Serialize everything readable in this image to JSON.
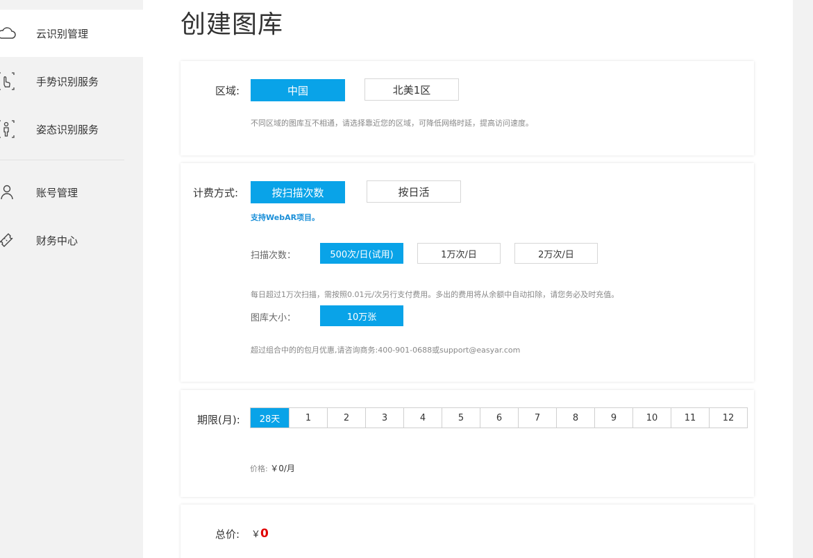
{
  "sidebar": {
    "items": [
      {
        "label": "云识别管理",
        "icon": "cloud-icon",
        "active": true
      },
      {
        "label": "手势识别服务",
        "icon": "hand-gesture-icon"
      },
      {
        "label": "姿态识别服务",
        "icon": "body-pose-icon"
      },
      {
        "label": "账号管理",
        "icon": "user-icon"
      },
      {
        "label": "财务中心",
        "icon": "ticket-icon"
      }
    ]
  },
  "page": {
    "title": "创建图库"
  },
  "region": {
    "label": "区域:",
    "options": [
      "中国",
      "北美1区"
    ],
    "selected": "中国",
    "hint": "不同区域的图库互不相通，请选择靠近您的区域，可降低网络时延，提高访问速度。"
  },
  "billing": {
    "label": "计费方式:",
    "options": [
      "按扫描次数",
      "按日活"
    ],
    "selected": "按扫描次数",
    "webar_hint": "支持WebAR项目。",
    "scan_label": "扫描次数：",
    "scan_options": [
      "500次/日(试用)",
      "1万次/日",
      "2万次/日"
    ],
    "scan_selected": "500次/日(试用)",
    "scan_hint": "每日超过1万次扫描，需按照0.01元/次另行支付费用。多出的费用将从余额中自动扣除，请您务必及时充值。",
    "size_label": "图库大小：",
    "size_options": [
      "10万张"
    ],
    "contact_hint": "超过组合中的的包月优惠,请咨询商务:400-901-0688或support@easyar.com"
  },
  "period": {
    "label": "期限(月):",
    "options": [
      "28天",
      "1",
      "2",
      "3",
      "4",
      "5",
      "6",
      "7",
      "8",
      "9",
      "10",
      "11",
      "12"
    ],
    "selected": "28天",
    "price_label": "价格:",
    "price_value": "￥0/月"
  },
  "total": {
    "label": "总价:",
    "currency": "￥",
    "value": "0"
  },
  "colors": {
    "accent": "#09a3e8",
    "price_red": "#e00000"
  }
}
